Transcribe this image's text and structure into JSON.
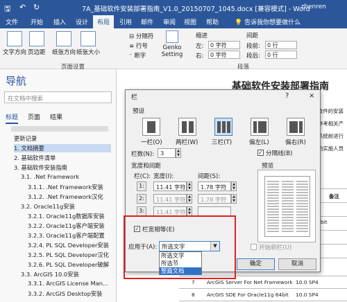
{
  "titlebar": {
    "title": "7A_基础软件安装部署指南_V1.0_20150707_1045.docx [兼容模式] - Word",
    "user": "zhenren"
  },
  "ribbon": {
    "tabs": [
      "文件",
      "开始",
      "插入",
      "设计",
      "布局",
      "引用",
      "邮件",
      "审阅",
      "视图",
      "帮助"
    ],
    "active_tab": "布局",
    "tell_me": "告诉我你想要做什么",
    "buttons": {
      "text_dir": "文字方向",
      "margins": "页边距",
      "orientation": "纸张方向",
      "size": "纸张大小",
      "breaks": "分隔符",
      "line_numbers": "行号",
      "hyphenation": "断字",
      "genko_1": "Genko",
      "genko_2": "Setting"
    },
    "indent": {
      "title": "缩进",
      "left_label": "左:",
      "right_label": "右:",
      "left_val": "0 字符",
      "right_val": "0 字符"
    },
    "spacing": {
      "title": "间距",
      "before_label": "段前:",
      "after_label": "段后:",
      "before_val": "0 行",
      "after_val": "0 行"
    },
    "groups": {
      "page_setup": "页面设置",
      "paragraph": "段落"
    }
  },
  "nav": {
    "title": "导航",
    "search_placeholder": "在文档中搜索",
    "tabs": [
      "标题",
      "页面",
      "结果"
    ],
    "items": [
      "更新记录",
      "1. 文档摘要",
      "2. 基础软件清单",
      "3. 基础软件安装指南",
      "3.1. .Net Framework",
      "3.1.1. .Net Framework安装",
      "3.1.2. .Net Framework汉化",
      "3.2. Oracle11g安装",
      "3.2.1. Oracle11g数据库安装",
      "3.2.2. Oracle11g客户端安装",
      "3.2.3. Oracle11g客户端配置",
      "3.2.4. PL SQL Developer安装",
      "3.2.5. PL SQL Developer汉化",
      "3.2.6. PL SQL Developer破解",
      "3.3. ArcGIS 10.0安装",
      "3.3.1. ArcGIS License Man...",
      "3.3.2. ArcGIS Desktop安装"
    ]
  },
  "doc": {
    "title": "基础软件安装部署指南",
    "fragments": [
      "软件的安装",
      "参考相关产",
      "系统前进行",
      "的实施人员",
      "备注",
      "bit"
    ],
    "rows": [
      {
        "no": "7",
        "name": "ArcGIS Server For Net Framework",
        "ver": "10.0 SP4"
      },
      {
        "no": "8",
        "name": "ArcGIS SDE For Oracle11g 64bit",
        "ver": "10.0 SP4"
      }
    ]
  },
  "dialog": {
    "title": "栏",
    "help": "?",
    "close": "×",
    "preset_label": "预设",
    "presets": [
      "一栏(O)",
      "两栏(W)",
      "三栏(T)",
      "偏左(L)",
      "偏右(R)"
    ],
    "num_cols_label": "栏数(N):",
    "num_cols": "3",
    "line_between": "分隔线(B)",
    "width_spacing_label": "宽度和间距",
    "preview_label": "预览",
    "col_header": "栏(C):",
    "width_header": "宽度(I):",
    "spacing_header": "间距(S):",
    "rows": [
      {
        "n": "1:",
        "width": "11.41 字符",
        "spacing": "1.78 字符"
      },
      {
        "n": "2:",
        "width": "11.41 字符",
        "spacing": "1.78 字符"
      },
      {
        "n": "3:",
        "width": "11.41 字符",
        "spacing": ""
      }
    ],
    "equal_width": "栏宽相等(E)",
    "apply_label": "应用于(A):",
    "apply_value": "所选文字",
    "apply_options": [
      "所选文字",
      "所选节",
      "整篇文档"
    ],
    "start_new_col": "开始新栏(U)",
    "ok": "确定",
    "cancel": "取消"
  },
  "colors": {
    "accent": "#2b579a",
    "highlight": "#e02020"
  }
}
